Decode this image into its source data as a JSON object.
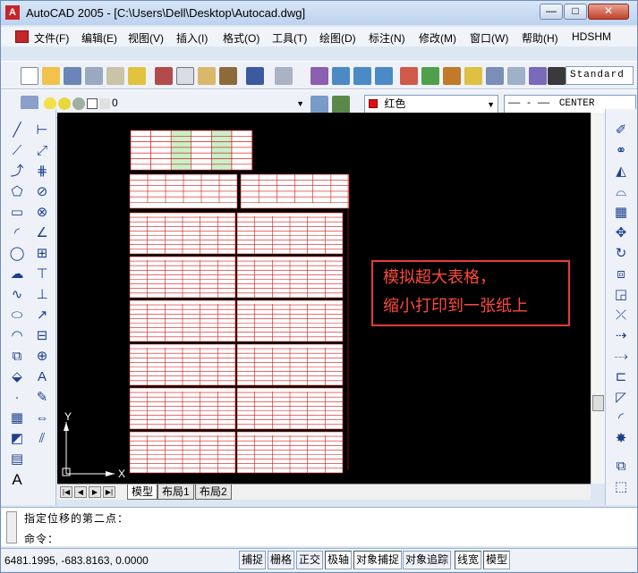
{
  "titlebar": {
    "app_icon": "A",
    "title": "AutoCAD 2005 - [C:\\Users\\Dell\\Desktop\\Autocad.dwg]",
    "minimize": "—",
    "maximize": "□",
    "close": "✕"
  },
  "menu": [
    "文件(F)",
    "编辑(E)",
    "视图(V)",
    "插入(I)",
    "格式(O)",
    "工具(T)",
    "绘图(D)",
    "标注(N)",
    "修改(M)",
    "窗口(W)",
    "帮助(H)",
    "HDSHM"
  ],
  "toolbar": {
    "text_style": "Standard"
  },
  "layers": {
    "current_layer": "0",
    "color": "红色",
    "linetype_pattern": "—— - ——",
    "linetype": "CENTER"
  },
  "annotation": {
    "line1": "模拟超大表格，",
    "line2": "缩小打印到一张纸上"
  },
  "ucs": {
    "x": "X",
    "y": "Y"
  },
  "tabs": [
    "模型",
    "布局1",
    "布局2"
  ],
  "command": {
    "line1": "指定位移的第二点：",
    "line2": "命令："
  },
  "status": {
    "coords": "6481.1995, -683.8163, 0.0000",
    "buttons": [
      "捕捉",
      "栅格",
      "正交",
      "极轴",
      "对象捕捉",
      "对象追踪",
      "线宽",
      "模型"
    ]
  },
  "colors": {
    "table_border": "#d01818",
    "annotation_border": "#e83a3a",
    "annotation_text": "#ff4a3a",
    "canvas": "#000000"
  }
}
